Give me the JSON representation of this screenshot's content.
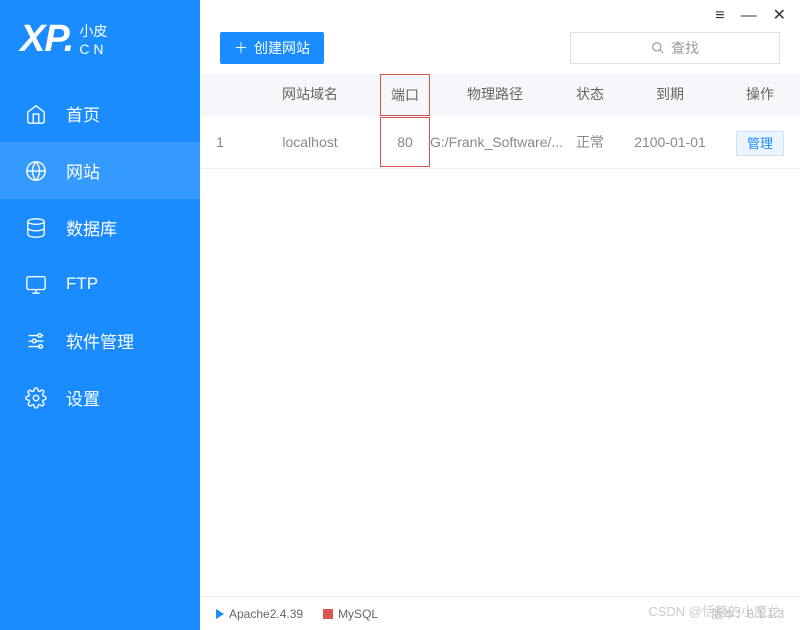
{
  "logo": {
    "main": "XP.",
    "sub1": "小皮",
    "sub2": "C N"
  },
  "nav": [
    {
      "label": "首页",
      "key": "home"
    },
    {
      "label": "网站",
      "key": "website"
    },
    {
      "label": "数据库",
      "key": "database"
    },
    {
      "label": "FTP",
      "key": "ftp"
    },
    {
      "label": "软件管理",
      "key": "software"
    },
    {
      "label": "设置",
      "key": "settings"
    }
  ],
  "toolbar": {
    "create": "创建网站",
    "search_placeholder": "查找"
  },
  "table": {
    "headers": {
      "domain": "网站域名",
      "port": "端口",
      "path": "物理路径",
      "status": "状态",
      "expire": "到期",
      "action": "操作"
    },
    "rows": [
      {
        "idx": "1",
        "domain": "localhost",
        "port": "80",
        "path": "G:/Frank_Software/...",
        "status": "正常",
        "expire": "2100-01-01",
        "action": "管理"
      }
    ]
  },
  "statusbar": {
    "apache": "Apache2.4.39",
    "mysql": "MySQL",
    "version": "版本：8.1.1.3"
  },
  "watermark": "CSDN @恬静的小魔龙"
}
